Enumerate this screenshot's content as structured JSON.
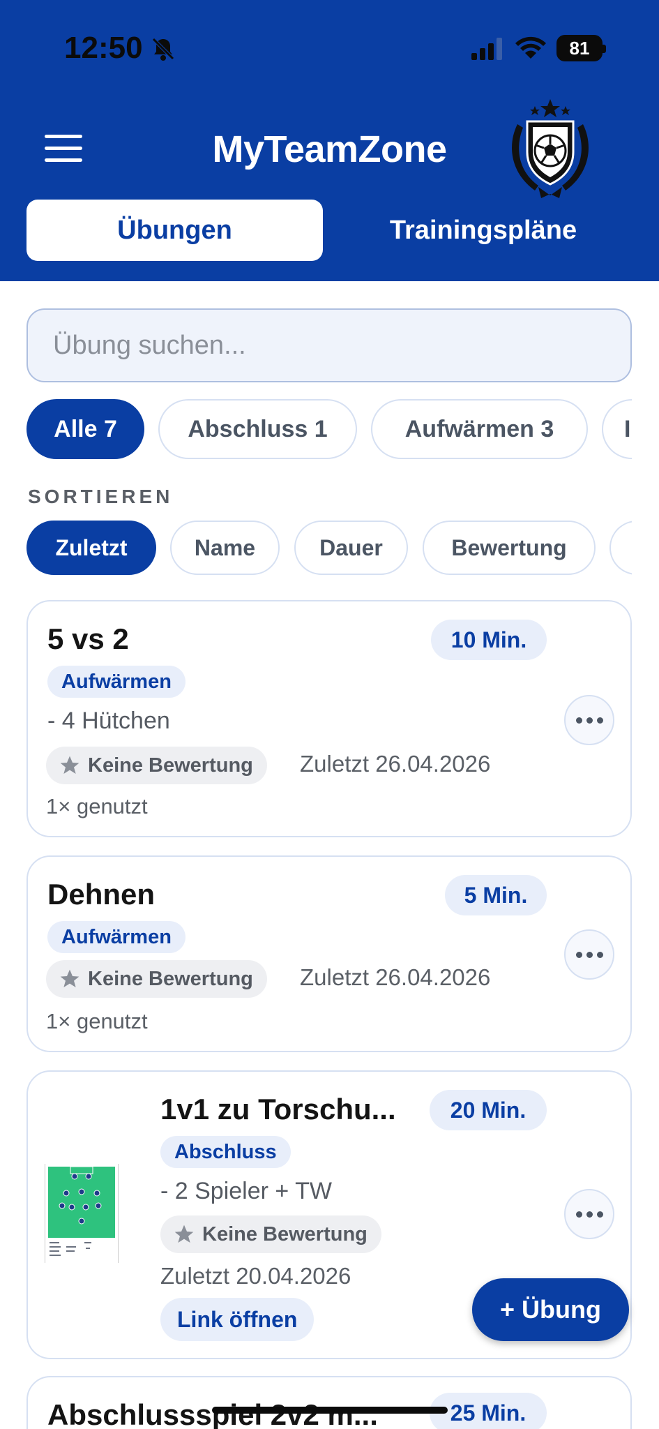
{
  "status_bar": {
    "time": "12:50",
    "battery": "81"
  },
  "header": {
    "title": "MyTeamZone"
  },
  "tabs": [
    {
      "label": "Übungen",
      "active": true
    },
    {
      "label": "Trainingspläne",
      "active": false
    }
  ],
  "search": {
    "placeholder": "Übung suchen..."
  },
  "filters": [
    {
      "label": "Alle 7",
      "active": true
    },
    {
      "label": "Abschluss 1",
      "active": false
    },
    {
      "label": "Aufwärmen 3",
      "active": false
    },
    {
      "label": "I",
      "active": false
    }
  ],
  "sort": {
    "label": "SORTIEREN",
    "options": [
      {
        "label": "Zuletzt",
        "active": true
      },
      {
        "label": "Name",
        "active": false
      },
      {
        "label": "Dauer",
        "active": false
      },
      {
        "label": "Bewertung",
        "active": false
      },
      {
        "label": "",
        "active": false
      }
    ]
  },
  "exercises": [
    {
      "title": "5 vs 2",
      "duration": "10 Min.",
      "category": "Aufwärmen",
      "description": "- 4 Hütchen",
      "rating": "Keine Bewertung",
      "last_used": "Zuletzt 26.04.2026",
      "usage": "1× genutzt"
    },
    {
      "title": "Dehnen",
      "duration": "5 Min.",
      "category": "Aufwärmen",
      "rating": "Keine Bewertung",
      "last_used": "Zuletzt 26.04.2026",
      "usage": "1× genutzt"
    },
    {
      "title": "1v1 zu Torschu...",
      "duration": "20 Min.",
      "category": "Abschluss",
      "description": "- 2 Spieler + TW",
      "rating": "Keine Bewertung",
      "last_used": "Zuletzt 20.04.2026",
      "link": "Link öffnen"
    },
    {
      "title": "Abschlussspiel 2v2 m...",
      "duration": "25 Min."
    }
  ],
  "fab": {
    "label": "+ Übung"
  },
  "colors": {
    "brand": "#0a3ea3",
    "chip_bg": "#e8eefa",
    "border": "#d6e0f2"
  }
}
